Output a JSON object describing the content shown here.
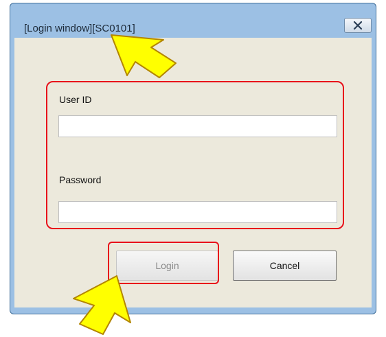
{
  "window": {
    "title": "[Login window][SC0101]"
  },
  "form": {
    "user_id_label": "User ID",
    "user_id_value": "",
    "password_label": "Password",
    "password_value": ""
  },
  "buttons": {
    "login_label": "Login",
    "cancel_label": "Cancel"
  },
  "icons": {
    "close": "close-icon",
    "arrow": "pointer-arrow-icon"
  },
  "colors": {
    "highlight": "#e8101a",
    "arrow_fill": "#ffff00",
    "arrow_stroke": "#b38600",
    "window_frame": "#9cc0e4",
    "client_bg": "#ece9dc"
  }
}
